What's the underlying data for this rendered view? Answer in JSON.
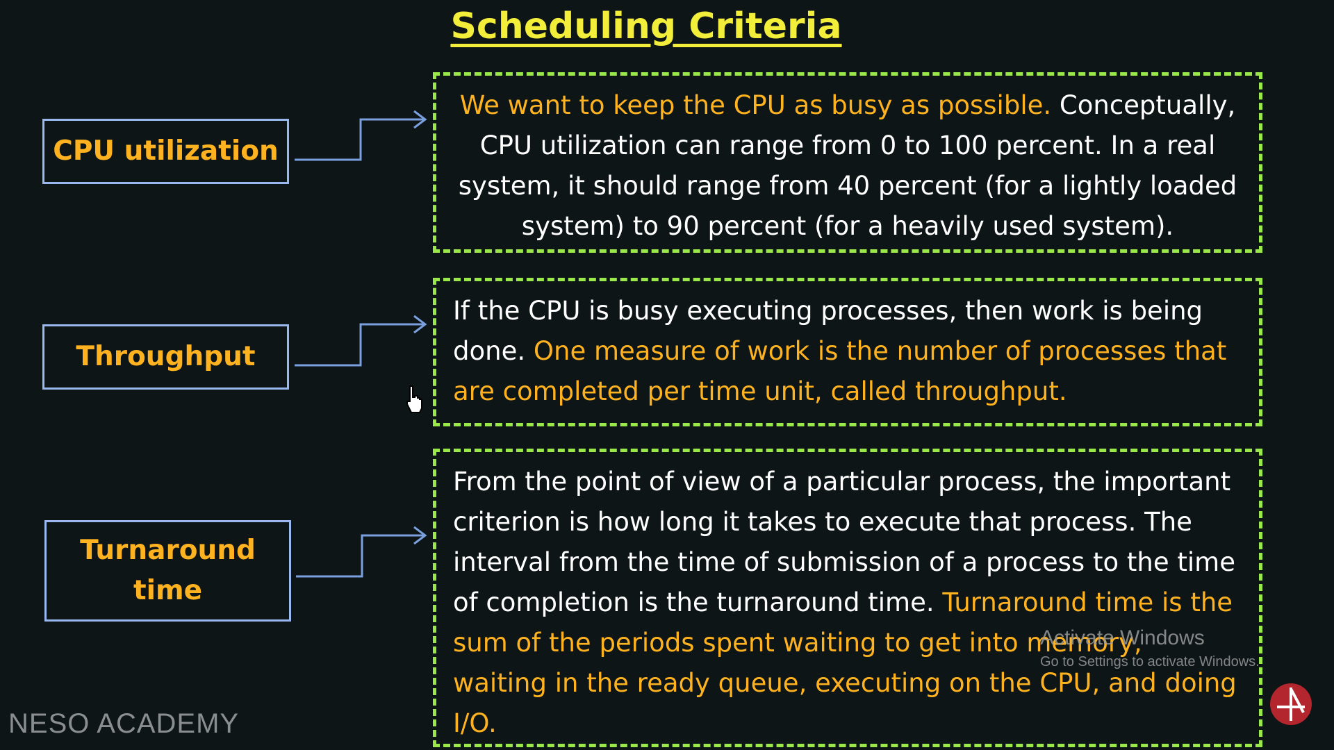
{
  "title": "Scheduling Criteria",
  "criteria": [
    {
      "term": "CPU utilization",
      "segments": [
        {
          "text": "We want to keep the CPU as busy as possible.",
          "highlight": true
        },
        {
          "text": " Conceptually, CPU utilization can range from 0 to 100 percent. In a real system, it should range from 40 percent (for a lightly loaded system) to 90 percent (for a heavily used system).",
          "highlight": false
        }
      ]
    },
    {
      "term": "Throughput",
      "segments": [
        {
          "text": "If the CPU is busy executing processes, then work is being done. ",
          "highlight": false
        },
        {
          "text": "One measure of work is the number of processes that are completed per time unit, called throughput.",
          "highlight": true
        }
      ]
    },
    {
      "term": "Turnaround time",
      "segments": [
        {
          "text": "From the point of view of a particular process, the important criterion is how long it takes to execute that process. The interval from the time of submission of a process to the time of completion is the turnaround time. ",
          "highlight": false
        },
        {
          "text": "Turnaround time is the sum of the periods spent waiting to get into memory, waiting in the ready queue, executing on the CPU, and doing I/O.",
          "highlight": true
        }
      ]
    }
  ],
  "watermark": "NESO ACADEMY",
  "activation": {
    "title": "Activate Windows",
    "subtitle": "Go to Settings to activate Windows."
  },
  "colors": {
    "background": "#0d1516",
    "title": "#f2ee3a",
    "highlight": "#ffb21f",
    "box_border": "#9ab8f0",
    "dashed_border": "#9be84b",
    "connector": "#7aa0df"
  }
}
